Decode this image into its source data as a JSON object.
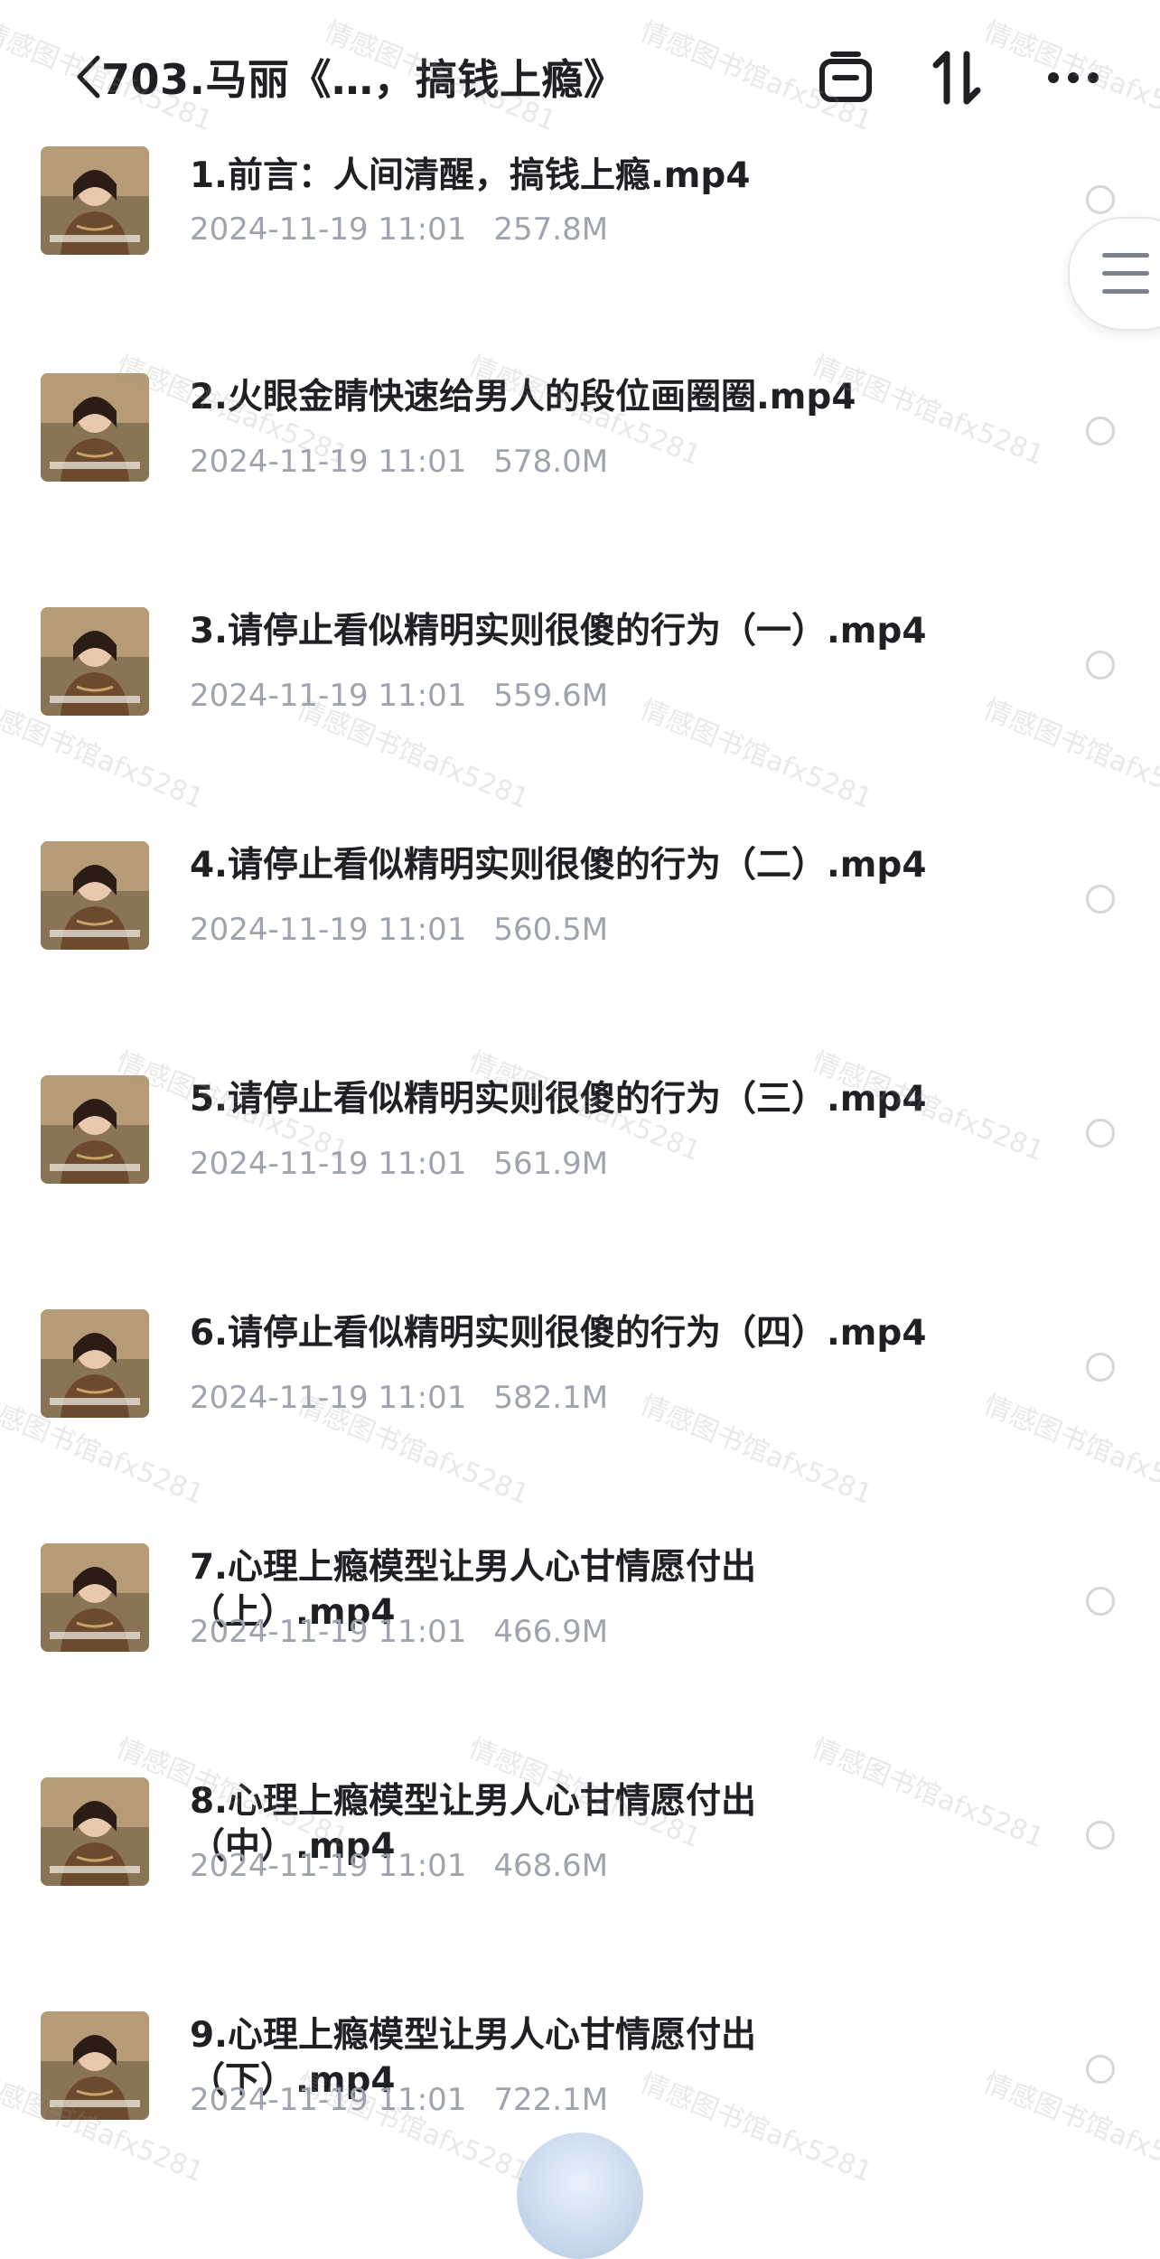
{
  "header": {
    "title": "703.马丽《…，搞钱上瘾》",
    "icons": [
      "back-chevron-icon",
      "window-icon",
      "sort-icon",
      "more-icon"
    ]
  },
  "files": [
    {
      "name": "1.前言：人间清醒，搞钱上瘾.mp4",
      "date": "2024-11-19 11:01",
      "size": "257.8M"
    },
    {
      "name": "2.火眼金睛快速给男人的段位画圈圈.mp4",
      "date": "2024-11-19 11:01",
      "size": "578.0M"
    },
    {
      "name": "3.请停止看似精明实则很傻的行为（一）.mp4",
      "date": "2024-11-19 11:01",
      "size": "559.6M"
    },
    {
      "name": "4.请停止看似精明实则很傻的行为（二）.mp4",
      "date": "2024-11-19 11:01",
      "size": "560.5M"
    },
    {
      "name": "5.请停止看似精明实则很傻的行为（三）.mp4",
      "date": "2024-11-19 11:01",
      "size": "561.9M"
    },
    {
      "name": "6.请停止看似精明实则很傻的行为（四）.mp4",
      "date": "2024-11-19 11:01",
      "size": "582.1M"
    },
    {
      "name": "7.心理上瘾模型让男人心甘情愿付出（上）.mp4",
      "date": "2024-11-19 11:01",
      "size": "466.9M"
    },
    {
      "name": "8.心理上瘾模型让男人心甘情愿付出（中）.mp4",
      "date": "2024-11-19 11:01",
      "size": "468.6M"
    },
    {
      "name": "9.心理上瘾模型让男人心甘情愿付出（下）.mp4",
      "date": "2024-11-19 11:01",
      "size": "722.1M"
    }
  ],
  "watermark": "情感图书馆afx5281",
  "colors": {
    "text": "#1f2024",
    "meta": "#9ea3ae",
    "radio_border": "#d3d6dc"
  }
}
